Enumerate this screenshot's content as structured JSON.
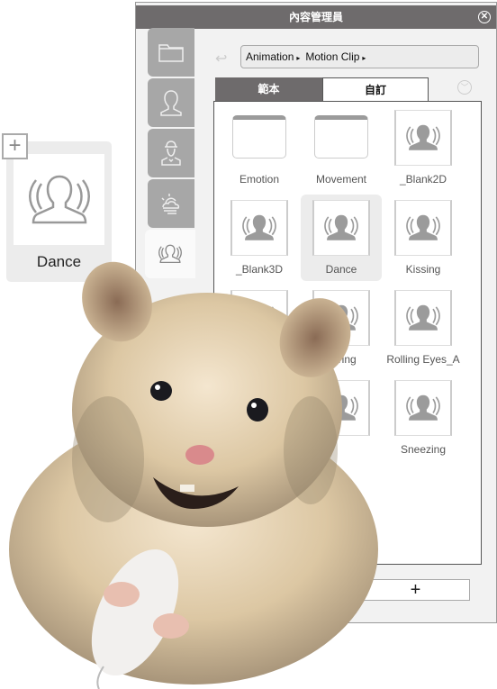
{
  "window": {
    "title": "內容管理員",
    "close_icon": "close-circle-icon"
  },
  "sidebar": {
    "tabs": [
      {
        "icon": "folder-icon"
      },
      {
        "icon": "person-icon"
      },
      {
        "icon": "costume-person-icon"
      },
      {
        "icon": "weather-icon"
      },
      {
        "icon": "motion-person-icon",
        "active": true
      }
    ]
  },
  "breadcrumb": {
    "items": [
      "Animation",
      "Motion Clip"
    ],
    "separator": "▸"
  },
  "tabs": [
    {
      "label": "範本",
      "active": false
    },
    {
      "label": "自訂",
      "active": true
    }
  ],
  "items": [
    {
      "label": "Emotion",
      "type": "folder"
    },
    {
      "label": "Movement",
      "type": "folder"
    },
    {
      "label": "_Blank2D",
      "type": "motion"
    },
    {
      "label": "_Blank3D",
      "type": "motion"
    },
    {
      "label": "Dance",
      "type": "motion",
      "selected": true
    },
    {
      "label": "Kissing",
      "type": "motion"
    },
    {
      "label": "",
      "type": "motion"
    },
    {
      "label": "bering",
      "type": "motion"
    },
    {
      "label": "Rolling Eyes_A",
      "type": "motion"
    },
    {
      "label": "",
      "type": "motion"
    },
    {
      "label": "",
      "type": "motion"
    },
    {
      "label": "Sneezing",
      "type": "motion"
    }
  ],
  "add_button": "+",
  "drag_ghost": {
    "label": "Dance",
    "plus": "+"
  },
  "colors": {
    "titlebar": "#6e6b6c",
    "sidetab": "#a7a7a7",
    "selected": "#ececec"
  }
}
